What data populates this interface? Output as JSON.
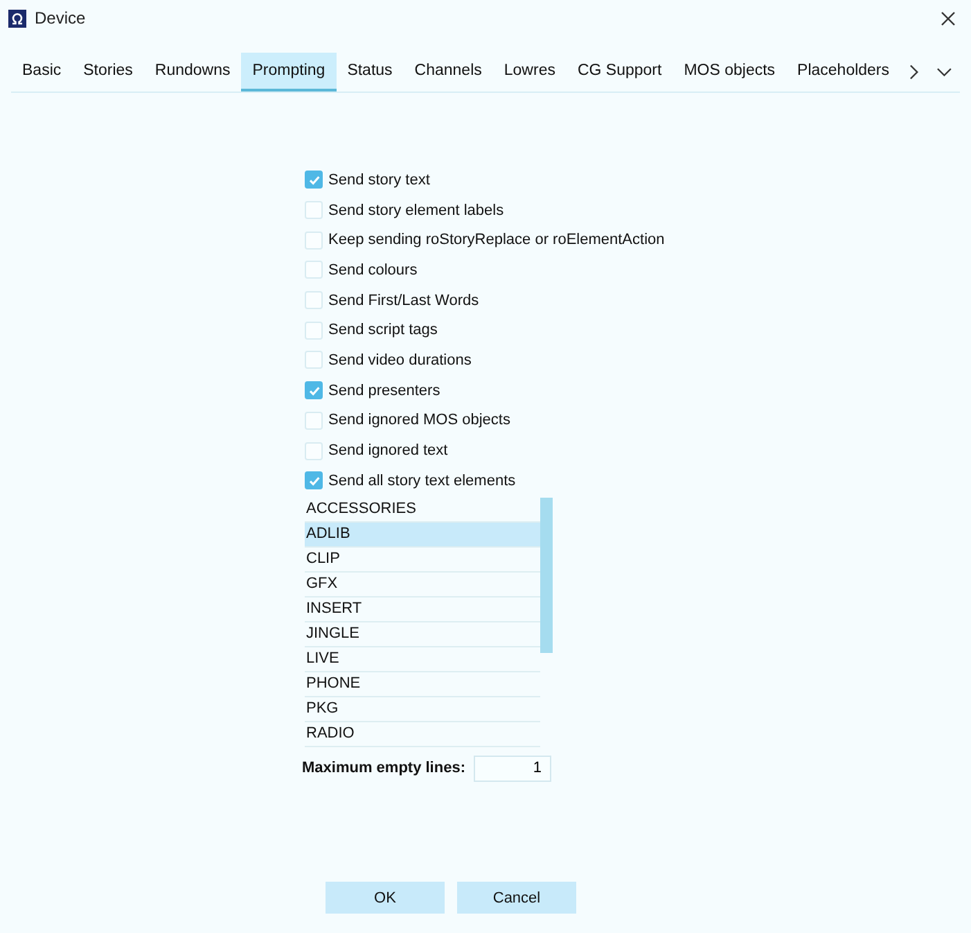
{
  "window": {
    "title": "Device"
  },
  "tabs": [
    {
      "label": "Basic",
      "selected": false
    },
    {
      "label": "Stories",
      "selected": false
    },
    {
      "label": "Rundowns",
      "selected": false
    },
    {
      "label": "Prompting",
      "selected": true
    },
    {
      "label": "Status",
      "selected": false
    },
    {
      "label": "Channels",
      "selected": false
    },
    {
      "label": "Lowres",
      "selected": false
    },
    {
      "label": "CG Support",
      "selected": false
    },
    {
      "label": "MOS objects",
      "selected": false
    },
    {
      "label": "Placeholders",
      "selected": false
    }
  ],
  "options": [
    {
      "label": "Send story text",
      "checked": true
    },
    {
      "label": "Send story element labels",
      "checked": false
    },
    {
      "label": "Keep sending roStoryReplace or roElementAction",
      "checked": false
    },
    {
      "label": "Send colours",
      "checked": false
    },
    {
      "label": "Send First/Last Words",
      "checked": false
    },
    {
      "label": "Send script tags",
      "checked": false
    },
    {
      "label": "Send video durations",
      "checked": false
    },
    {
      "label": "Send presenters",
      "checked": true
    },
    {
      "label": "Send ignored MOS objects",
      "checked": false
    },
    {
      "label": "Send ignored text",
      "checked": false
    },
    {
      "label": "Send all story text elements",
      "checked": true
    }
  ],
  "element_list": [
    {
      "label": "ACCESSORIES",
      "selected": false
    },
    {
      "label": "ADLIB",
      "selected": true
    },
    {
      "label": "CLIP",
      "selected": false
    },
    {
      "label": "GFX",
      "selected": false
    },
    {
      "label": "INSERT",
      "selected": false
    },
    {
      "label": "JINGLE",
      "selected": false
    },
    {
      "label": "LIVE",
      "selected": false
    },
    {
      "label": "PHONE",
      "selected": false
    },
    {
      "label": "PKG",
      "selected": false
    },
    {
      "label": "RADIO",
      "selected": false
    }
  ],
  "max_empty_lines": {
    "label": "Maximum empty lines:",
    "value": "1"
  },
  "buttons": [
    "OK",
    "Cancel"
  ]
}
